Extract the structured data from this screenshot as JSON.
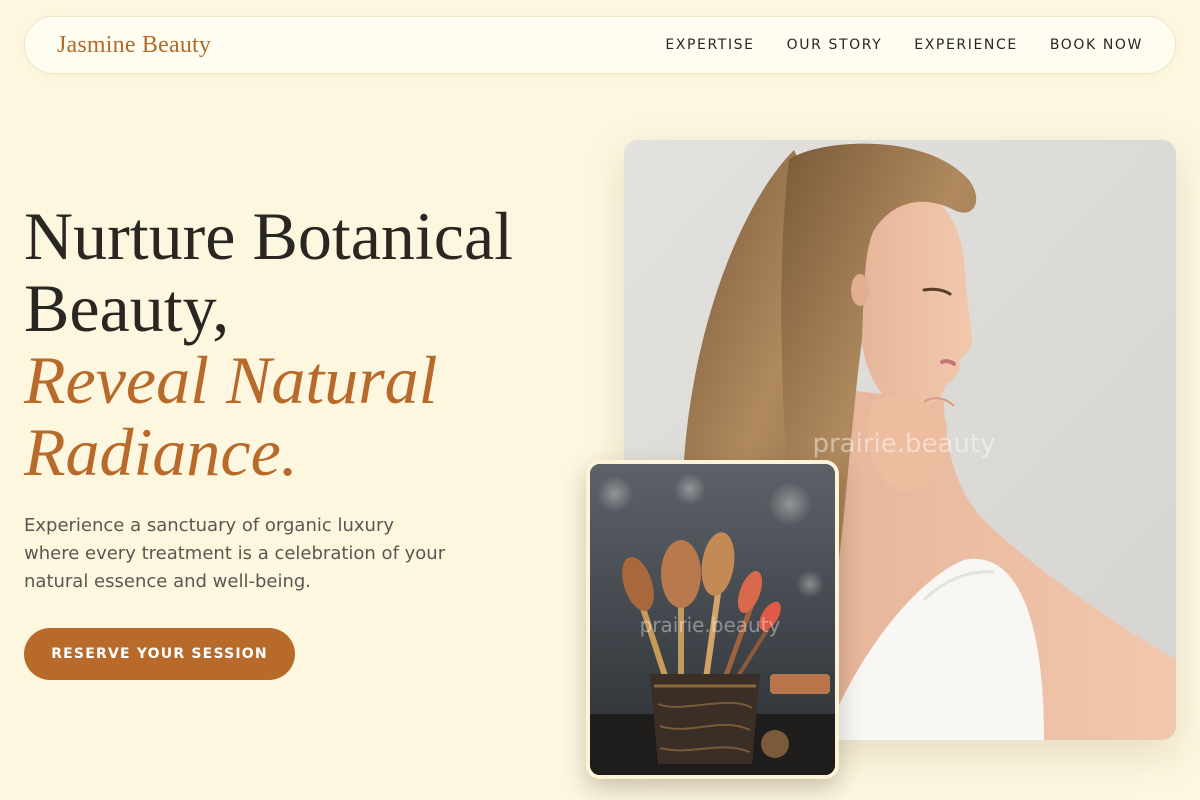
{
  "brand": {
    "name": "Jasmine Beauty"
  },
  "nav": {
    "items": [
      {
        "label": "EXPERTISE"
      },
      {
        "label": "OUR STORY"
      },
      {
        "label": "EXPERIENCE"
      },
      {
        "label": "BOOK NOW"
      }
    ]
  },
  "hero": {
    "title_line1": "Nurture Botanical",
    "title_line2": "Beauty,",
    "accent_line1": "Reveal Natural",
    "accent_line2": "Radiance.",
    "description": "Experience a sanctuary of organic luxury where every treatment is a celebration of your natural essence and well-being.",
    "cta_label": "RESERVE YOUR SESSION"
  },
  "images": {
    "main_watermark": "prairie.beauty",
    "small_watermark": "prairie.beauty"
  },
  "colors": {
    "background": "#fdf7e0",
    "accent": "#b86a2a",
    "text": "#2a2622"
  }
}
